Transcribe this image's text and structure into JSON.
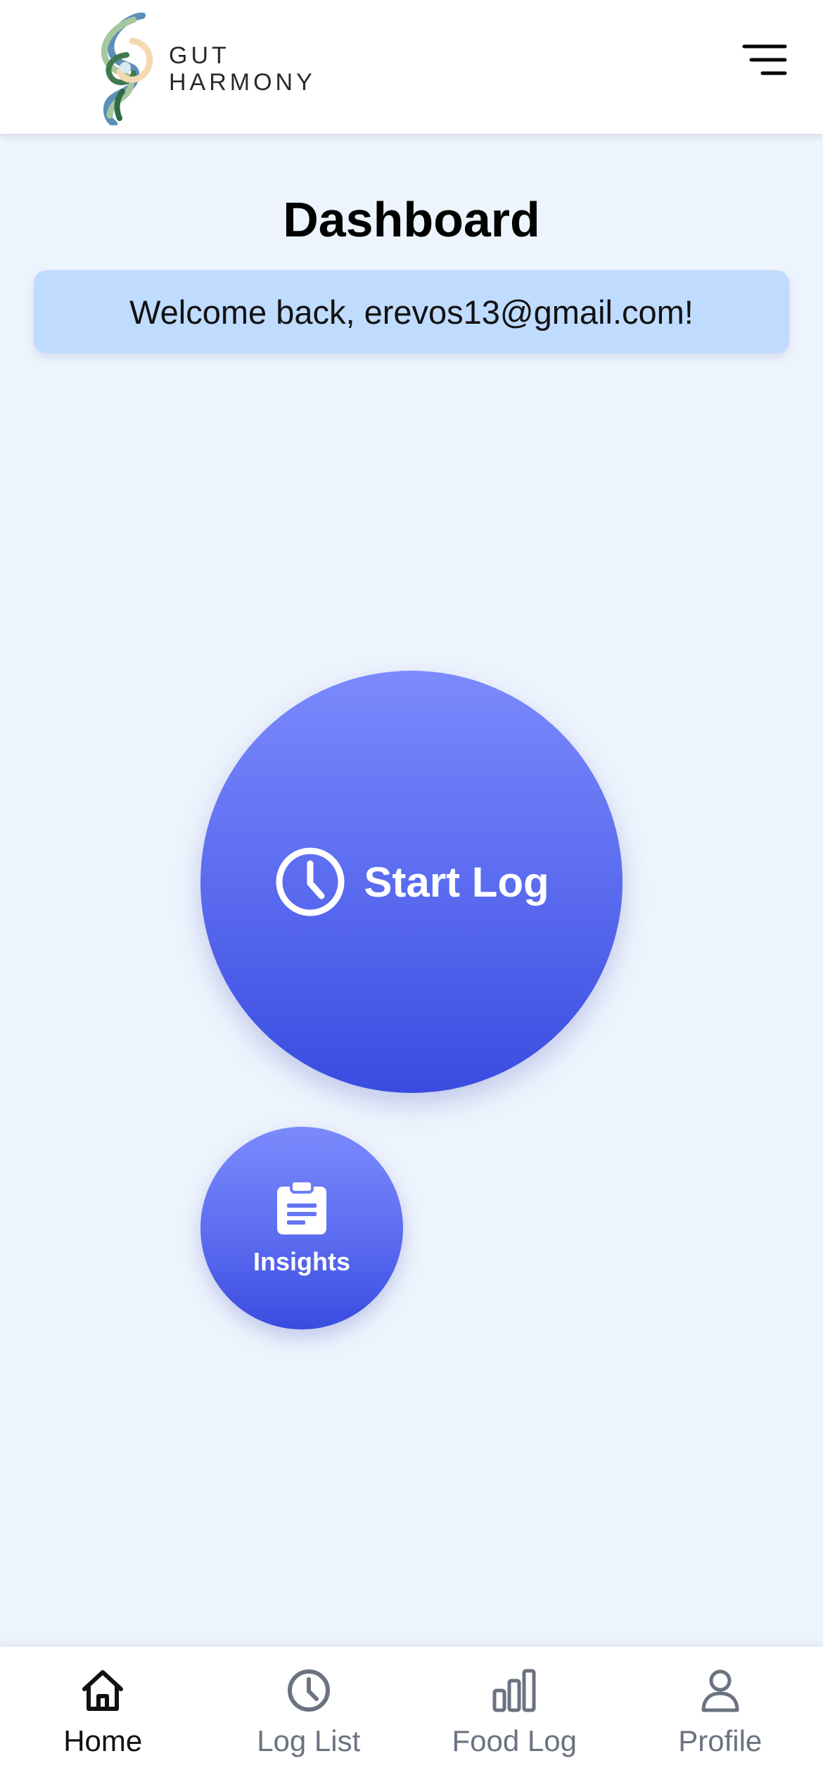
{
  "header": {
    "brand_line1": "GUT",
    "brand_line2": "HARMONY",
    "menu_icon": "menu-icon"
  },
  "main": {
    "title": "Dashboard",
    "welcome": "Welcome back, erevos13@gmail.com!",
    "start_log_label": "Start Log",
    "start_log_icon": "clock-icon",
    "insights_label": "Insights",
    "insights_icon": "clipboard-icon"
  },
  "nav": {
    "items": [
      {
        "label": "Home",
        "icon": "home-icon",
        "active": true
      },
      {
        "label": "Log List",
        "icon": "clock-icon",
        "active": false
      },
      {
        "label": "Food Log",
        "icon": "bar-chart-icon",
        "active": false
      },
      {
        "label": "Profile",
        "icon": "user-icon",
        "active": false
      }
    ]
  },
  "colors": {
    "background": "#eef4fd",
    "welcome_bg": "#bfdbfe",
    "button_gradient_top": "#7b8afc",
    "button_gradient_bottom": "#3a4ce0",
    "nav_inactive": "#6b7280"
  }
}
